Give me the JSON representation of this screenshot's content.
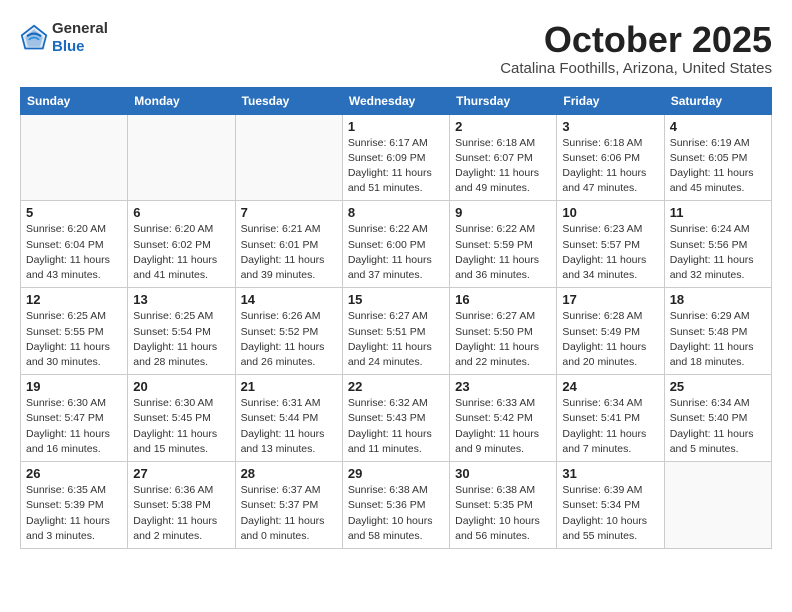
{
  "header": {
    "logo_general": "General",
    "logo_blue": "Blue",
    "month": "October 2025",
    "location": "Catalina Foothills, Arizona, United States"
  },
  "days_of_week": [
    "Sunday",
    "Monday",
    "Tuesday",
    "Wednesday",
    "Thursday",
    "Friday",
    "Saturday"
  ],
  "weeks": [
    [
      {
        "day": "",
        "info": ""
      },
      {
        "day": "",
        "info": ""
      },
      {
        "day": "",
        "info": ""
      },
      {
        "day": "1",
        "info": "Sunrise: 6:17 AM\nSunset: 6:09 PM\nDaylight: 11 hours\nand 51 minutes."
      },
      {
        "day": "2",
        "info": "Sunrise: 6:18 AM\nSunset: 6:07 PM\nDaylight: 11 hours\nand 49 minutes."
      },
      {
        "day": "3",
        "info": "Sunrise: 6:18 AM\nSunset: 6:06 PM\nDaylight: 11 hours\nand 47 minutes."
      },
      {
        "day": "4",
        "info": "Sunrise: 6:19 AM\nSunset: 6:05 PM\nDaylight: 11 hours\nand 45 minutes."
      }
    ],
    [
      {
        "day": "5",
        "info": "Sunrise: 6:20 AM\nSunset: 6:04 PM\nDaylight: 11 hours\nand 43 minutes."
      },
      {
        "day": "6",
        "info": "Sunrise: 6:20 AM\nSunset: 6:02 PM\nDaylight: 11 hours\nand 41 minutes."
      },
      {
        "day": "7",
        "info": "Sunrise: 6:21 AM\nSunset: 6:01 PM\nDaylight: 11 hours\nand 39 minutes."
      },
      {
        "day": "8",
        "info": "Sunrise: 6:22 AM\nSunset: 6:00 PM\nDaylight: 11 hours\nand 37 minutes."
      },
      {
        "day": "9",
        "info": "Sunrise: 6:22 AM\nSunset: 5:59 PM\nDaylight: 11 hours\nand 36 minutes."
      },
      {
        "day": "10",
        "info": "Sunrise: 6:23 AM\nSunset: 5:57 PM\nDaylight: 11 hours\nand 34 minutes."
      },
      {
        "day": "11",
        "info": "Sunrise: 6:24 AM\nSunset: 5:56 PM\nDaylight: 11 hours\nand 32 minutes."
      }
    ],
    [
      {
        "day": "12",
        "info": "Sunrise: 6:25 AM\nSunset: 5:55 PM\nDaylight: 11 hours\nand 30 minutes."
      },
      {
        "day": "13",
        "info": "Sunrise: 6:25 AM\nSunset: 5:54 PM\nDaylight: 11 hours\nand 28 minutes."
      },
      {
        "day": "14",
        "info": "Sunrise: 6:26 AM\nSunset: 5:52 PM\nDaylight: 11 hours\nand 26 minutes."
      },
      {
        "day": "15",
        "info": "Sunrise: 6:27 AM\nSunset: 5:51 PM\nDaylight: 11 hours\nand 24 minutes."
      },
      {
        "day": "16",
        "info": "Sunrise: 6:27 AM\nSunset: 5:50 PM\nDaylight: 11 hours\nand 22 minutes."
      },
      {
        "day": "17",
        "info": "Sunrise: 6:28 AM\nSunset: 5:49 PM\nDaylight: 11 hours\nand 20 minutes."
      },
      {
        "day": "18",
        "info": "Sunrise: 6:29 AM\nSunset: 5:48 PM\nDaylight: 11 hours\nand 18 minutes."
      }
    ],
    [
      {
        "day": "19",
        "info": "Sunrise: 6:30 AM\nSunset: 5:47 PM\nDaylight: 11 hours\nand 16 minutes."
      },
      {
        "day": "20",
        "info": "Sunrise: 6:30 AM\nSunset: 5:45 PM\nDaylight: 11 hours\nand 15 minutes."
      },
      {
        "day": "21",
        "info": "Sunrise: 6:31 AM\nSunset: 5:44 PM\nDaylight: 11 hours\nand 13 minutes."
      },
      {
        "day": "22",
        "info": "Sunrise: 6:32 AM\nSunset: 5:43 PM\nDaylight: 11 hours\nand 11 minutes."
      },
      {
        "day": "23",
        "info": "Sunrise: 6:33 AM\nSunset: 5:42 PM\nDaylight: 11 hours\nand 9 minutes."
      },
      {
        "day": "24",
        "info": "Sunrise: 6:34 AM\nSunset: 5:41 PM\nDaylight: 11 hours\nand 7 minutes."
      },
      {
        "day": "25",
        "info": "Sunrise: 6:34 AM\nSunset: 5:40 PM\nDaylight: 11 hours\nand 5 minutes."
      }
    ],
    [
      {
        "day": "26",
        "info": "Sunrise: 6:35 AM\nSunset: 5:39 PM\nDaylight: 11 hours\nand 3 minutes."
      },
      {
        "day": "27",
        "info": "Sunrise: 6:36 AM\nSunset: 5:38 PM\nDaylight: 11 hours\nand 2 minutes."
      },
      {
        "day": "28",
        "info": "Sunrise: 6:37 AM\nSunset: 5:37 PM\nDaylight: 11 hours\nand 0 minutes."
      },
      {
        "day": "29",
        "info": "Sunrise: 6:38 AM\nSunset: 5:36 PM\nDaylight: 10 hours\nand 58 minutes."
      },
      {
        "day": "30",
        "info": "Sunrise: 6:38 AM\nSunset: 5:35 PM\nDaylight: 10 hours\nand 56 minutes."
      },
      {
        "day": "31",
        "info": "Sunrise: 6:39 AM\nSunset: 5:34 PM\nDaylight: 10 hours\nand 55 minutes."
      },
      {
        "day": "",
        "info": ""
      }
    ]
  ]
}
